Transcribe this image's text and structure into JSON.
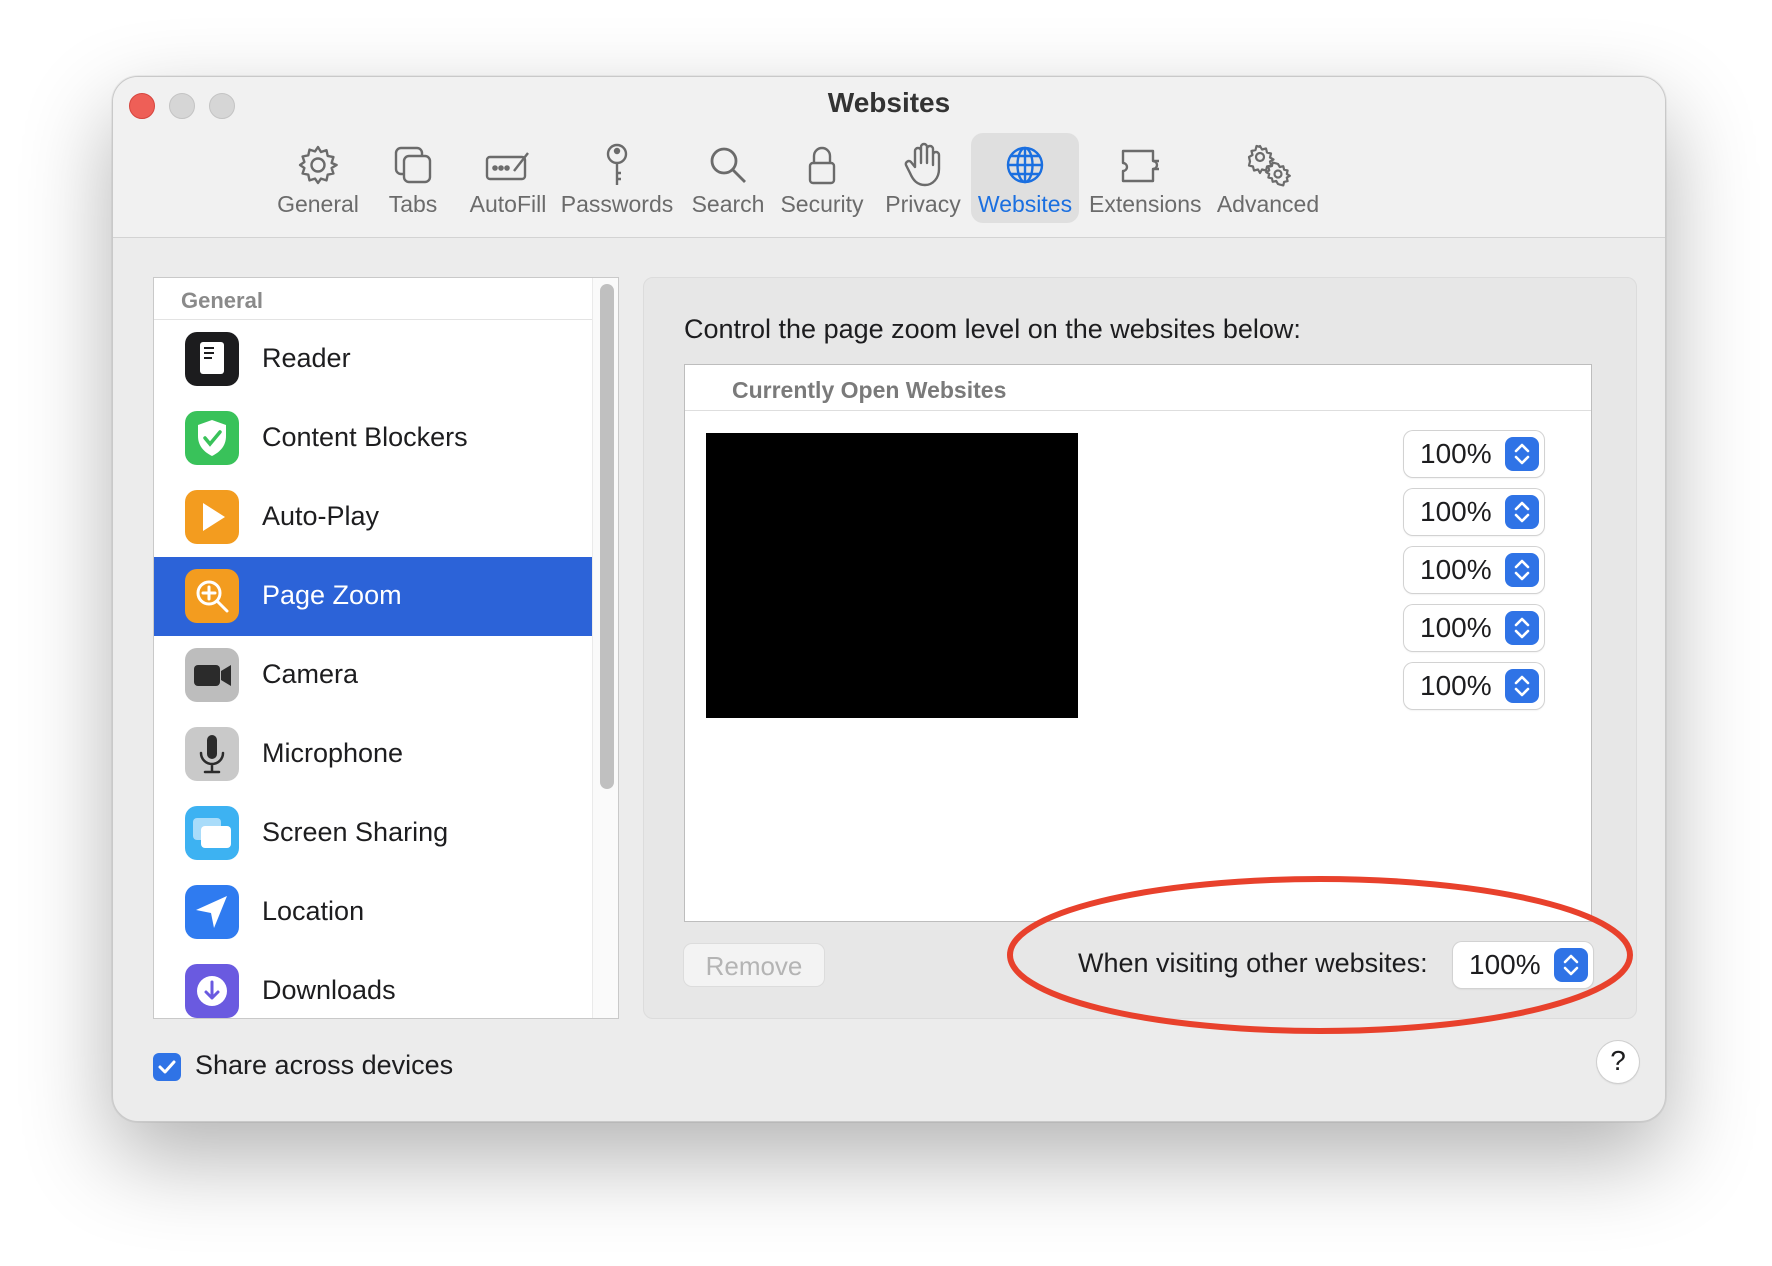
{
  "window": {
    "title": "Websites"
  },
  "toolbar": {
    "items": [
      {
        "label": "General",
        "icon": "gear-icon",
        "active": false
      },
      {
        "label": "Tabs",
        "icon": "tabs-icon",
        "active": false
      },
      {
        "label": "AutoFill",
        "icon": "autofill-icon",
        "active": false
      },
      {
        "label": "Passwords",
        "icon": "key-icon",
        "active": false
      },
      {
        "label": "Search",
        "icon": "search-icon",
        "active": false
      },
      {
        "label": "Security",
        "icon": "lock-icon",
        "active": false
      },
      {
        "label": "Privacy",
        "icon": "hand-icon",
        "active": false
      },
      {
        "label": "Websites",
        "icon": "globe-icon",
        "active": true
      },
      {
        "label": "Extensions",
        "icon": "puzzle-icon",
        "active": false
      },
      {
        "label": "Advanced",
        "icon": "gears-icon",
        "active": false
      }
    ],
    "active_color": "#1a6fe0"
  },
  "sidebar": {
    "header": "General",
    "selected_color": "#2c63d8",
    "items": [
      {
        "label": "Reader",
        "icon": "reader-icon",
        "selected": false
      },
      {
        "label": "Content Blockers",
        "icon": "shield-check-icon",
        "selected": false
      },
      {
        "label": "Auto-Play",
        "icon": "play-icon",
        "selected": false
      },
      {
        "label": "Page Zoom",
        "icon": "zoom-icon",
        "selected": true
      },
      {
        "label": "Camera",
        "icon": "camera-icon",
        "selected": false
      },
      {
        "label": "Microphone",
        "icon": "microphone-icon",
        "selected": false
      },
      {
        "label": "Screen Sharing",
        "icon": "screen-sharing-icon",
        "selected": false
      },
      {
        "label": "Location",
        "icon": "location-icon",
        "selected": false
      },
      {
        "label": "Downloads",
        "icon": "download-icon",
        "selected": false
      }
    ]
  },
  "panel": {
    "description": "Control the page zoom level on the websites below:",
    "table_header": "Currently Open Websites",
    "site_zoom_values": [
      "100%",
      "100%",
      "100%",
      "100%",
      "100%"
    ],
    "remove_label": "Remove",
    "other_label": "When visiting other websites:",
    "other_value": "100%"
  },
  "footer": {
    "share_label": "Share across devices",
    "share_checked": true,
    "help_label": "?"
  },
  "annotation": {
    "color": "#e8412c"
  }
}
